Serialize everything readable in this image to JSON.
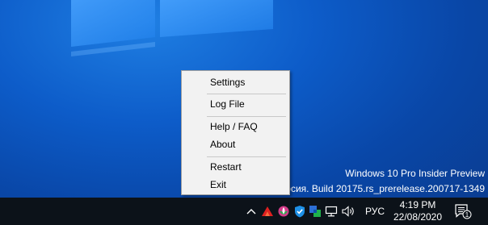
{
  "desktop": {
    "watermark_line1": "Windows 10 Pro Insider Preview",
    "watermark_line2": "версия. Build 20175.rs_prerelease.200717-1349"
  },
  "context_menu": {
    "items": [
      {
        "label": "Settings"
      },
      {
        "label": "Log File"
      },
      {
        "label": "Help / FAQ"
      },
      {
        "label": "About"
      },
      {
        "label": "Restart"
      },
      {
        "label": "Exit"
      }
    ]
  },
  "taskbar": {
    "tray": {
      "show_hidden_icon": "chevron-up-icon",
      "language": "РУС",
      "clock_time": "4:19 PM",
      "clock_date": "22/08/2020",
      "notification_count": "1"
    }
  },
  "colors": {
    "desktop_blue": "#0d5cc9",
    "taskbar": "#0c1219",
    "menu_background": "#f2f2f2"
  }
}
